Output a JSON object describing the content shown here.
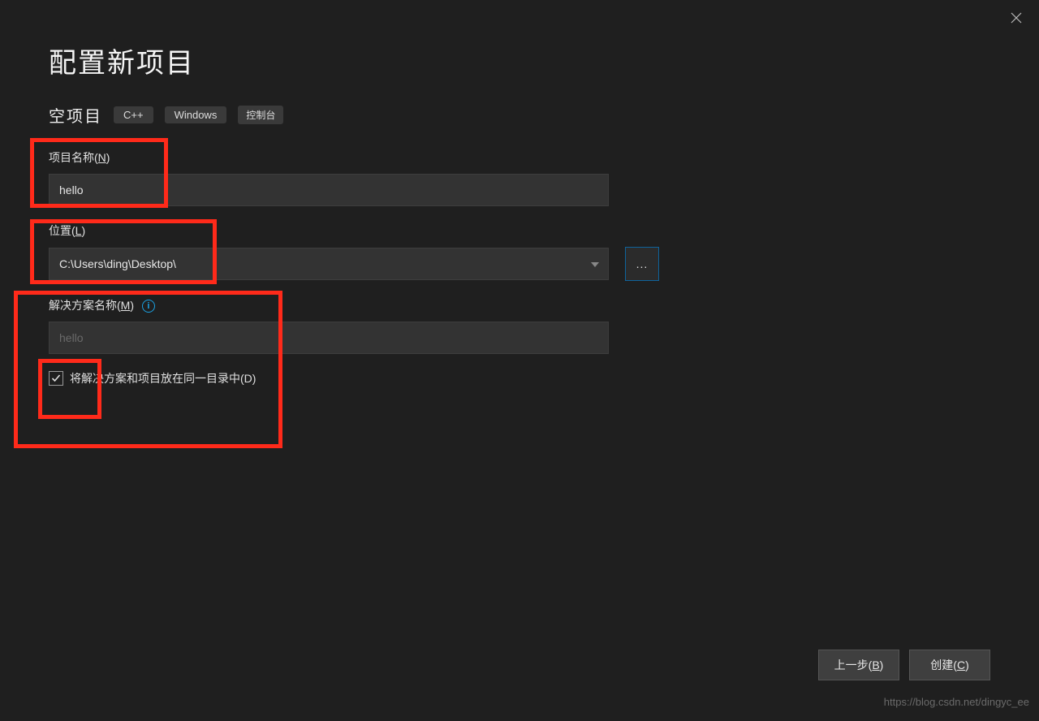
{
  "page": {
    "title": "配置新项目",
    "subtitle": "空项目",
    "tags": [
      "C++",
      "Windows",
      "控制台"
    ]
  },
  "form": {
    "project_name": {
      "label_pre": "项目名称(",
      "label_hot": "N",
      "label_post": ")",
      "value": "hello"
    },
    "location": {
      "label_pre": "位置(",
      "label_hot": "L",
      "label_post": ")",
      "value": "C:\\Users\\ding\\Desktop\\",
      "browse": "..."
    },
    "solution_name": {
      "label_pre": "解决方案名称(",
      "label_hot": "M",
      "label_post": ")",
      "info": "i",
      "value": "hello"
    },
    "same_dir": {
      "label_pre": "将解决方案和项目放在同一目录中(",
      "label_hot": "D",
      "label_post": ")",
      "checked": true
    }
  },
  "footer": {
    "back_pre": "上一步(",
    "back_hot": "B",
    "back_post": ")",
    "create_pre": "创建(",
    "create_hot": "C",
    "create_post": ")"
  },
  "watermark": "https://blog.csdn.net/dingyc_ee"
}
